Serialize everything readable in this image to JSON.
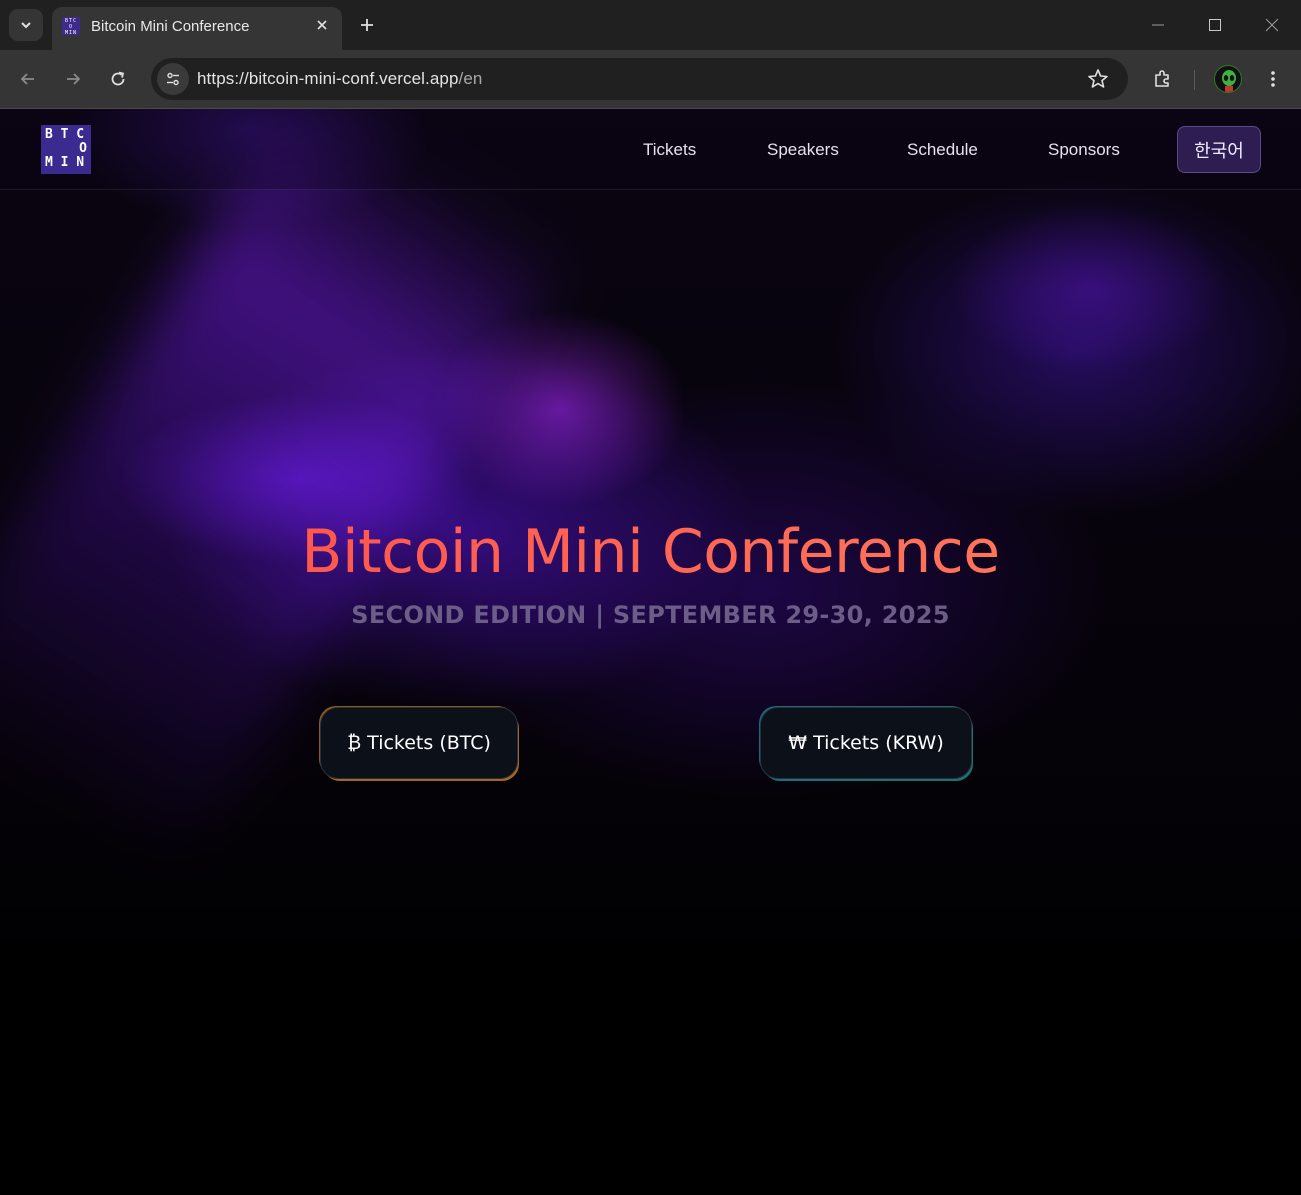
{
  "browser": {
    "tab_title": "Bitcoin Mini Conference",
    "favicon_text": "BTC O MIN",
    "url_main": "https://bitcoin-mini-conf.vercel.app",
    "url_path": "/en"
  },
  "site": {
    "logo": {
      "row1": "B T C",
      "row2": "O",
      "row3": "M I N"
    },
    "nav": {
      "tickets": "Tickets",
      "speakers": "Speakers",
      "schedule": "Schedule",
      "sponsors": "Sponsors",
      "language": "한국어"
    },
    "hero": {
      "title": "Bitcoin Mini Conference",
      "subtitle": "SECOND EDITION | SEPTEMBER 29-30, 2025"
    },
    "buttons": {
      "btc": "₿ Tickets (BTC)",
      "krw": "₩ Tickets (KRW)"
    }
  },
  "colors": {
    "title_gradient_start": "#ff4b47",
    "title_gradient_end": "#ff8060",
    "subtitle": "#6b5d87",
    "btc_accent": "#e69628",
    "krw_accent": "#28bebe"
  }
}
